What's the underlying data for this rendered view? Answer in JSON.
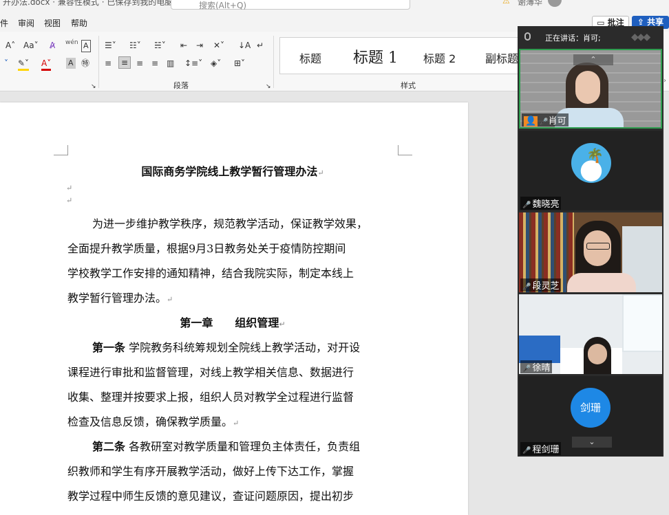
{
  "window": {
    "doc_title": "开办法.docx · 兼容性模式 · 已保存到我的电脑",
    "search_placeholder": "搜索(Alt+Q)",
    "user_name": "谢薄华"
  },
  "menu": [
    "件",
    "审阅",
    "视图",
    "帮助"
  ],
  "top_buttons": {
    "comment": "批注",
    "share": "共享"
  },
  "ribbon": {
    "paragraph_group": "段落",
    "styles_group": "样式",
    "styles": [
      {
        "label": "标题"
      },
      {
        "label": "标题 1"
      },
      {
        "label": "标题 2"
      },
      {
        "label": "副标题"
      }
    ],
    "phonetic": "wén"
  },
  "document": {
    "title": "国际商务学院线上教学暂行管理办法",
    "intro_lines": [
      "为进一步维护教学秩序，规范教学活动，保证教学效果，",
      "全面提升教学质量，根据9月3日教务处关于疫情防控期间",
      "学校教学工作安排的通知精神，结合我院实际，制定本线上",
      "教学暂行管理办法。"
    ],
    "chapter": "第一章　　组织管理",
    "article1": {
      "label": "第一条",
      "lines": [
        "学院教务科统筹规划全院线上教学活动，对开设",
        "课程进行审批和监督管理，对线上教学相关信息、数据进行",
        "收集、整理并按要求上报，组织人员对教学全过程进行监督",
        "检查及信息反馈，确保教学质量。"
      ]
    },
    "article2": {
      "label": "第二条",
      "lines": [
        "各教研室对教学质量和管理负主体责任，负责组",
        "织教师和学生有序开展教学活动，做好上传下达工作，掌握",
        "教学过程中师生反馈的意见建议，查证问题原因，提出初步"
      ]
    }
  },
  "meeting": {
    "speaking": "正在讲话：肖可;",
    "participants": [
      {
        "name": "肖可"
      },
      {
        "name": "魏晓亮"
      },
      {
        "name": "段灵芝"
      },
      {
        "name": "徐晴"
      },
      {
        "name": "程剑珊",
        "avatar_text": "剑珊"
      }
    ]
  },
  "colors": {
    "accent": "#1f5fbf",
    "avatar_blue": "#1e88e5",
    "panel": "#2b2b2b"
  }
}
